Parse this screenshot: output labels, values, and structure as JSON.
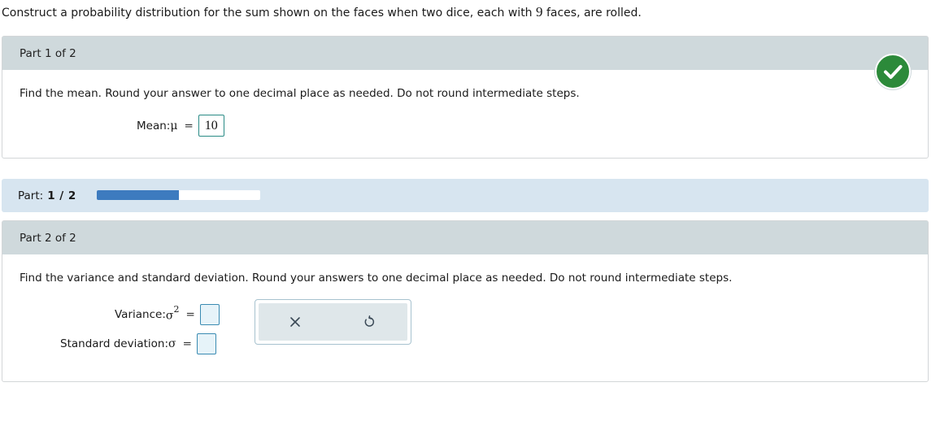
{
  "intro": {
    "before": "Construct a probability distribution for the sum shown on the faces when two dice, each with ",
    "faces": "9",
    "after": " faces, are rolled."
  },
  "part1": {
    "header": "Part 1 of 2",
    "prompt": "Find the mean. Round your answer to one decimal place as needed. Do not round intermediate steps.",
    "mean_label": "Mean: ",
    "mu": "μ",
    "equals": "=",
    "mean_value": "10",
    "status_icon": "check-icon",
    "status_color": "#2c8a3a"
  },
  "progress": {
    "label": "Part:",
    "value_text": "1 / 2",
    "fraction": 0.5,
    "fill_color": "#3d7bbf"
  },
  "part2": {
    "header": "Part 2 of 2",
    "prompt": "Find the variance and standard deviation. Round your answers to one decimal place as needed. Do not round intermediate steps.",
    "variance_label": "Variance: ",
    "sigma": "σ",
    "sup": "2",
    "equals": "=",
    "sd_label": "Standard deviation: ",
    "variance_value": "",
    "sd_value": "",
    "tools": {
      "clear_icon": "close-icon",
      "undo_icon": "undo-icon"
    }
  }
}
